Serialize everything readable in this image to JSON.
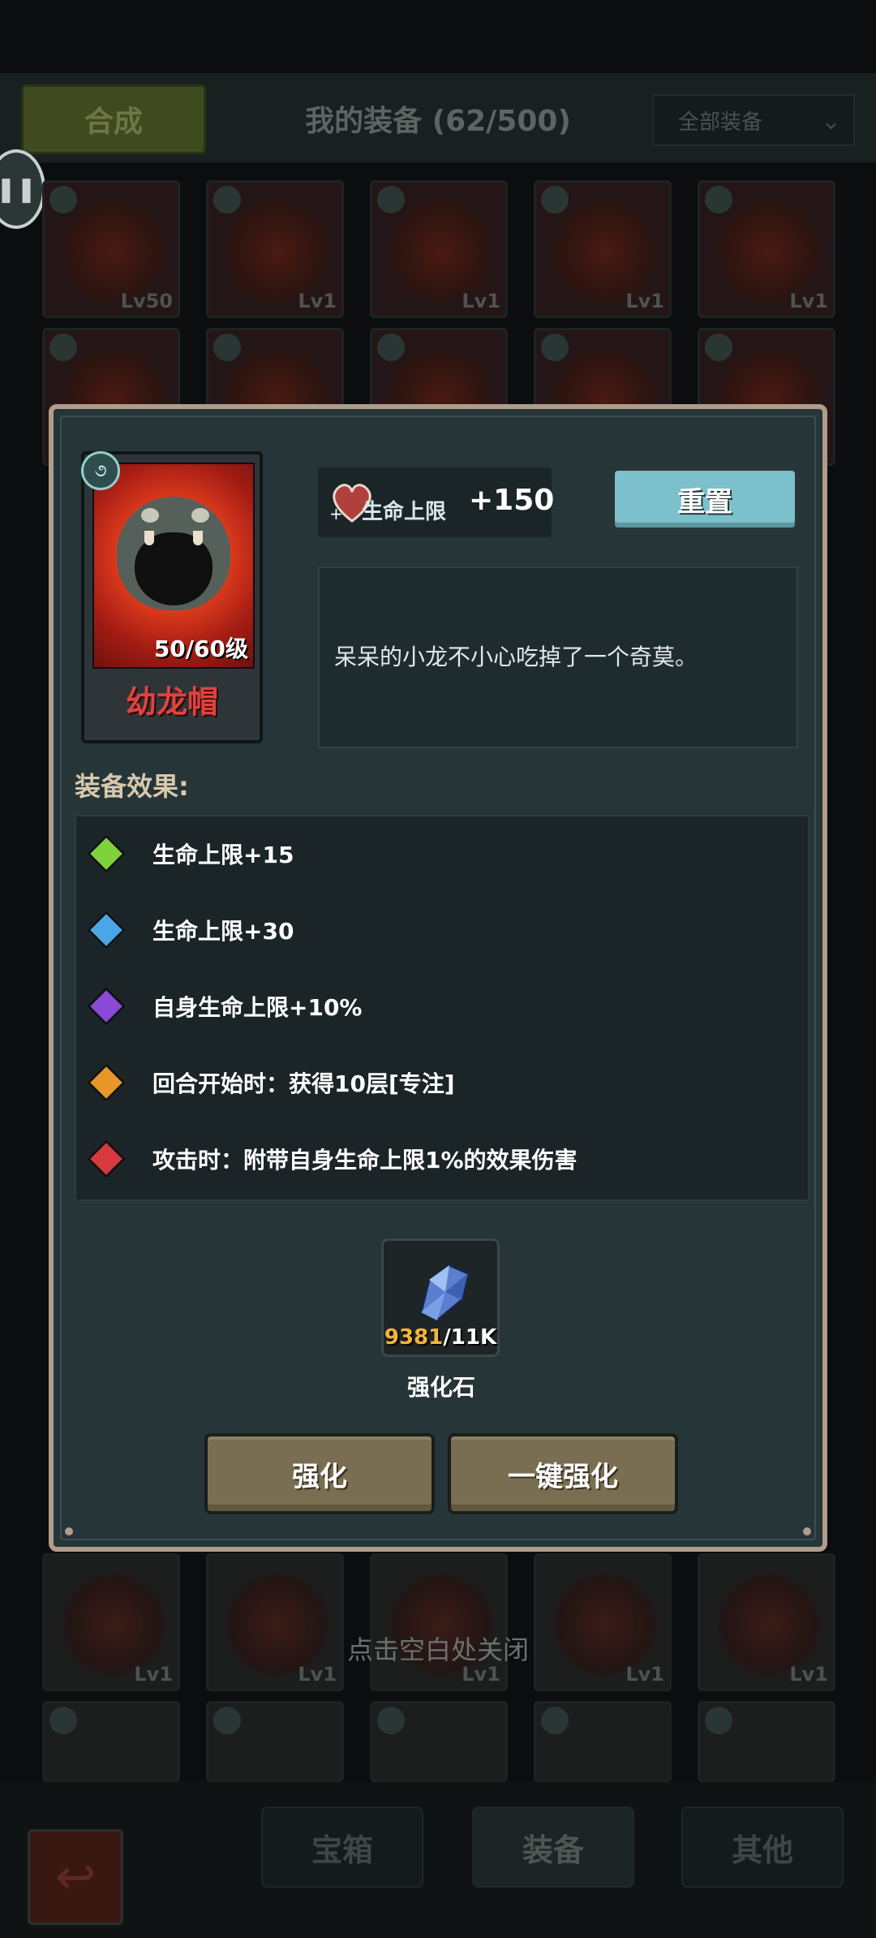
{
  "header": {
    "synthesize_label": "合成",
    "title": "我的装备 (62/500)",
    "filter_label": "全部装备"
  },
  "background_grid": {
    "level_labels": [
      "Lv50",
      "Lv1",
      "Lv1",
      "Lv1",
      "Lv1",
      "Lv1",
      "Lv1",
      "Lv1",
      "Lv1",
      "Lv1"
    ]
  },
  "close_hint": "点击空白处关闭",
  "bottom_tabs": [
    "宝箱",
    "装备",
    "其他"
  ],
  "item": {
    "name": "幼龙帽",
    "level_text": "50/60级",
    "stat_label": "生命上限",
    "stat_value": "+150",
    "description": "呆呆的小龙不小心吃掉了一个奇莫。"
  },
  "reset_label": "重置",
  "effects_title": "装备效果:",
  "effects": [
    {
      "text": "生命上限+15",
      "color": "#7fd23c"
    },
    {
      "text": "生命上限+30",
      "color": "#4aa6e6"
    },
    {
      "text": "自身生命上限+10%",
      "color": "#8a4ad6"
    },
    {
      "text": "回合开始时：获得10层[专注]",
      "color": "#e8962a"
    },
    {
      "text": "攻击时：附带自身生命上限1%的效果伤害",
      "color": "#d63a3e"
    }
  ],
  "material": {
    "name": "强化石",
    "current": "9381",
    "max": "/11K"
  },
  "buttons": {
    "enhance": "强化",
    "auto_enhance": "一键强化"
  }
}
